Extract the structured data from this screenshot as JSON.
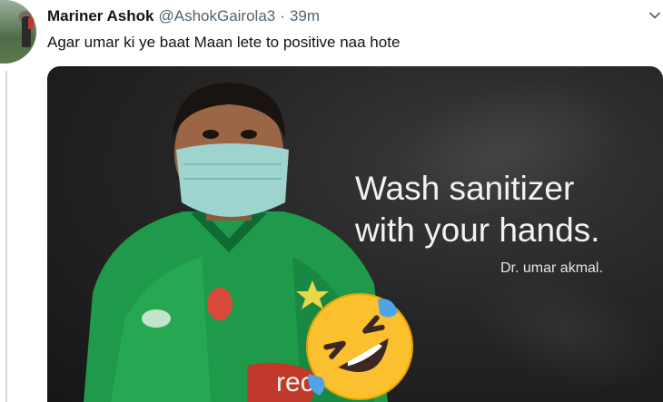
{
  "tweet": {
    "display_name": "Mariner Ashok",
    "handle": "@AshokGairola3",
    "separator": "·",
    "timestamp": "39m",
    "text": "Agar umar ki ye baat Maan lete to positive naa hote"
  },
  "media": {
    "quote_line1": "Wash sanitizer",
    "quote_line2": "with your hands.",
    "attribution": "Dr. umar akmal."
  },
  "icons": {
    "caret": "chevron-down-icon",
    "emoji": "rolling-on-floor-laughing-emoji"
  }
}
